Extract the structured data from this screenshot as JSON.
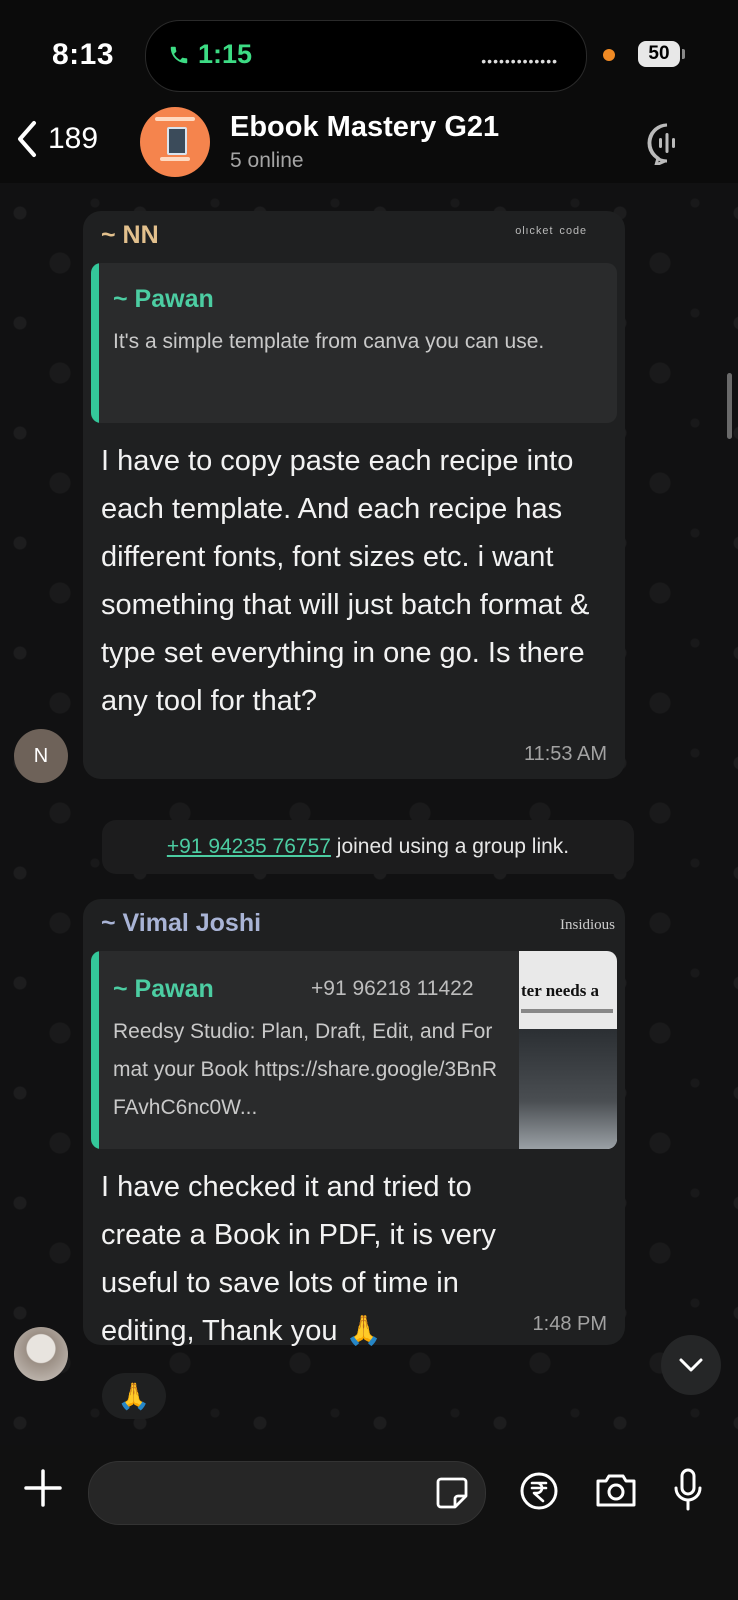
{
  "status_bar": {
    "time": "8:13",
    "call_time": "1:15",
    "battery": "50",
    "colors": {
      "call": "#3ddc84",
      "privacy_dot": "#f08a24"
    }
  },
  "header": {
    "back_count": "189",
    "group_name": "Ebook Mastery G21",
    "subtitle": "5 online",
    "avatar_color": "#f5844d"
  },
  "messages": [
    {
      "sender": "~ NN",
      "sender_color": "#e2c08d",
      "sender_tag": "ᵒˡᶦᶜᵏᵉᵗ ᶜᵒᵈᵉ",
      "quote": {
        "name": "~ Pawan",
        "text": "It's a simple template from canva you can use."
      },
      "text": "I have to copy paste each recipe into each template. And each recipe has different fonts, font sizes etc. i want something that will just batch format & type set everything in one go. Is there any tool for that?",
      "time": "11:53 AM",
      "avatar_initial": "N"
    },
    {
      "sender": "~ Vimal Joshi",
      "sender_color": "#a9b4d6",
      "sender_tag": "Insidious",
      "quote": {
        "name": "~ Pawan",
        "phone": "+91 96218 11422",
        "text": "Reedsy Studio: Plan, Draft, Edit, and Format your Book https://share.google/3BnRFAvhC6nc0W...",
        "thumb_text": "ter needs a"
      },
      "text": "I have checked it and tried to create a Book in PDF, it is very useful to save lots of time in editing, Thank you 🙏",
      "time": "1:48 PM",
      "reaction": "🙏"
    }
  ],
  "system_message": {
    "phone": "+91 94235 76757",
    "text": "joined using a group link."
  },
  "composer": {
    "placeholder": ""
  },
  "icons": [
    "back-chevron-icon",
    "voice-chat-icon",
    "scroll-down-icon",
    "plus-icon",
    "sticker-icon",
    "rupee-icon",
    "camera-icon",
    "mic-icon"
  ]
}
